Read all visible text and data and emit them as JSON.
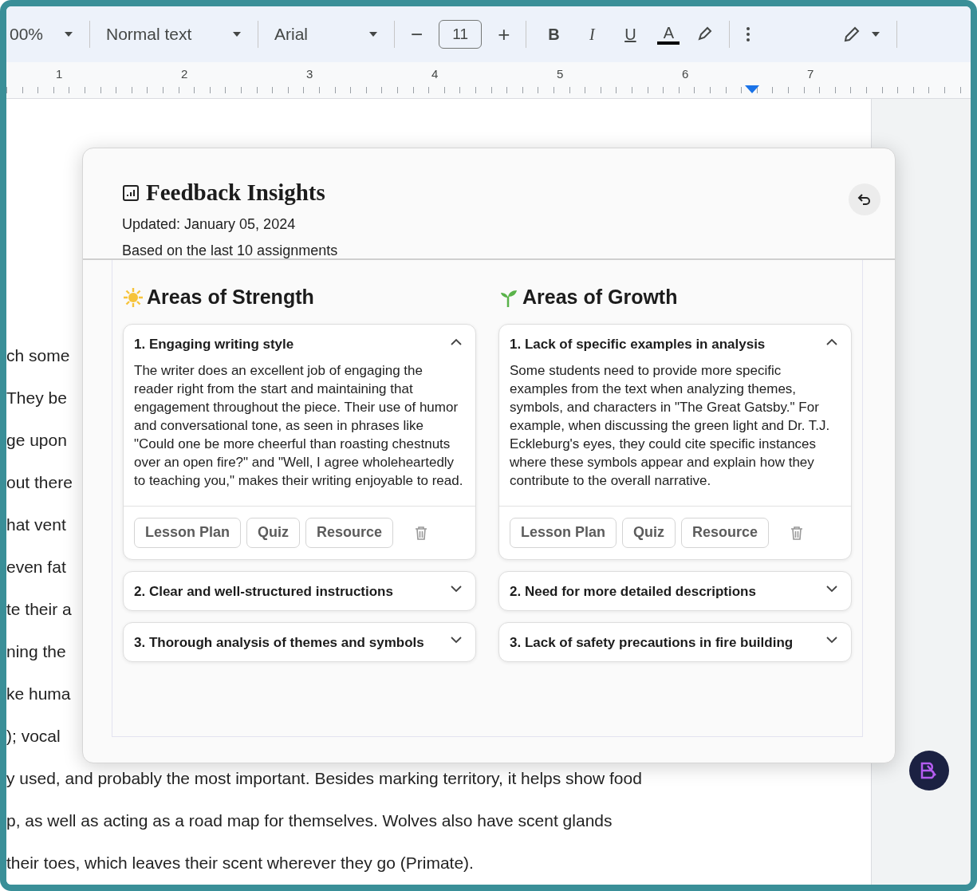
{
  "toolbar": {
    "zoom": "00%",
    "style": "Normal text",
    "font": "Arial",
    "font_size": "11",
    "minus": "−",
    "plus": "+",
    "format_buttons": [
      "B",
      "I",
      "U",
      "A"
    ]
  },
  "ruler": [
    "1",
    "2",
    "3",
    "4",
    "5",
    "6",
    "7"
  ],
  "document_lines": [
    "ch some",
    "They be",
    "ge upon",
    "out there",
    "hat vent",
    "even fat",
    "te their a",
    "ning the",
    "ke huma",
    "); vocal",
    "y used, and probably the most important.  Besides marking territory, it helps show food",
    "p, as well as acting as a road map for themselves.  Wolves also have scent glands",
    "their toes, which leaves their scent wherever they go (Primate)."
  ],
  "panel": {
    "title": "Feedback Insights",
    "updated": "Updated: January 05, 2024",
    "based_on": "Based on the last 10 assignments",
    "columns": [
      {
        "kind": "strength",
        "title": "Areas of Strength",
        "items": [
          {
            "title": "1. Engaging writing style",
            "expanded": true,
            "body": "The writer does an excellent job of engaging the reader right from the start and maintaining that engagement throughout the piece. Their use of humor and conversational tone, as seen in phrases like \"Could one be more cheerful than roasting chestnuts over an open fire?\" and \"Well, I agree wholeheartedly to teaching you,\" makes their writing enjoyable to read.",
            "actions": [
              "Lesson Plan",
              "Quiz",
              "Resource"
            ]
          },
          {
            "title": "2. Clear and well-structured instructions",
            "expanded": false
          },
          {
            "title": "3. Thorough analysis of themes and symbols",
            "expanded": false
          }
        ]
      },
      {
        "kind": "growth",
        "title": "Areas of Growth",
        "items": [
          {
            "title": "1. Lack of specific examples in analysis",
            "expanded": true,
            "body": "Some students need to provide more specific examples from the text when analyzing themes, symbols, and characters in \"The Great Gatsby.\" For example, when discussing the green light and Dr. T.J. Eckleburg's eyes, they could cite specific instances where these symbols appear and explain how they contribute to the overall narrative.",
            "actions": [
              "Lesson Plan",
              "Quiz",
              "Resource"
            ]
          },
          {
            "title": "2. Need for more detailed descriptions",
            "expanded": false
          },
          {
            "title": "3. Lack of safety precautions in fire building",
            "expanded": false
          }
        ]
      }
    ]
  }
}
